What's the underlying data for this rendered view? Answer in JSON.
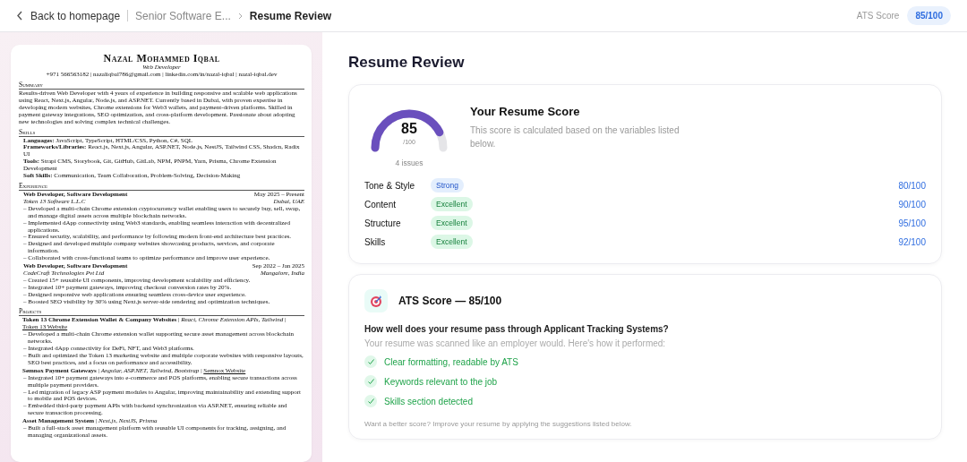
{
  "topbar": {
    "back": "Back to homepage",
    "crumb": "Senior Software E...",
    "current": "Resume Review",
    "ats_label": "ATS Score",
    "ats_value": "85/100"
  },
  "resume": {
    "name": "Nazal Mohammed Iqbal",
    "role": "Web Developer",
    "contact": "+971 566563182 | nazaliqbal786@gmail.com | linkedin.com/in/nazal-iqbal | nazal-iqbal.dev",
    "summary_heading": "Summary",
    "summary": "Results-driven Web Developer with 4 years of experience in building responsive and scalable web applications using React, Next.js, Angular, Node.js, and ASP.NET. Currently based in Dubai, with proven expertise in developing modern websites, Chrome extensions for Web3 wallets, and payment-driven platforms. Skilled in payment gateway integrations, SEO optimization, and cross-platform development. Passionate about adopting new technologies and solving complex technical challenges.",
    "skills_heading": "Skills",
    "skills": [
      "**Languages:** JavaScript, TypeScript, HTML/CSS, Python, C#, SQL",
      "**Frameworks/Libraries:** React.js, Next.js, Angular, ASP.NET, Node.js, NestJS, Tailwind CSS, Shadcn, Radix UI",
      "**Tools:** Strapi CMS, Storybook, Git, GitHub, GitLab, NPM, PNPM, Yarn, Prisma, Chrome Extension Development",
      "**Soft Skills:** Communication, Team Collaboration, Problem-Solving, Decision-Making"
    ],
    "experience_heading": "Experience",
    "jobs": [
      {
        "title": "Web Developer, Software Development",
        "dates": "May 2025 – Present",
        "company": "Token 13 Software L.L.C",
        "place": "Dubai, UAE",
        "bullets": [
          "– Developed a multi-chain Chrome extension cryptocurrency wallet enabling users to securely buy, sell, swap, and manage digital assets across multiple blockchain networks.",
          "– Implemented dApp connectivity using Web3 standards, enabling seamless interaction with decentralized applications.",
          "– Ensured security, scalability, and performance by following modern front-end architecture best practices.",
          "– Designed and developed multiple company websites showcasing products, services, and corporate information.",
          "– Collaborated with cross-functional teams to optimize performance and improve user experience."
        ]
      },
      {
        "title": "Web Developer, Software Development",
        "dates": "Sep 2022 – Jan 2025",
        "company": "CodeCraft Technologies Pvt Ltd",
        "place": "Mangalore, India",
        "bullets": [
          "– Created 15+ reusable UI components, improving development scalability and efficiency.",
          "– Integrated 10+ payment gateways, improving checkout conversion rates by 20%.",
          "– Designed responsive web applications ensuring seamless cross-device user experience.",
          "– Boosted SEO visibility by 30% using Next.js server-side rendering and optimization techniques."
        ]
      }
    ],
    "projects_heading": "Projects",
    "projects": [
      {
        "header": "**Token 13 Chrome Extension Wallet & Company Websites** | *React, Chrome Extension APIs, Tailwind* |",
        "link": "Token 13 Website",
        "bullets": [
          "– Developed a multi-chain Chrome extension wallet supporting secure asset management across blockchain networks.",
          "– Integrated dApp connectivity for DeFi, NFT, and Web3 platforms.",
          "– Built and optimized the Token 13 marketing website and multiple corporate websites with responsive layouts, SEO best practices, and a focus on performance and accessibility."
        ]
      },
      {
        "header": "**Semnox Payment Gateways** | *Angular, ASP.NET, Tailwind, Bootstrap* |",
        "link": "Semnox Website",
        "bullets": [
          "– Integrated 10+ payment gateways into e-commerce and POS platforms, enabling secure transactions across multiple payment providers.",
          "– Led migration of legacy ASP payment modules to Angular, improving maintainability and extending support to mobile and POS devices.",
          "– Embedded third-party payment APIs with backend synchronization via ASP.NET, ensuring reliable and secure transaction processing."
        ]
      },
      {
        "header": "**Asset Management System** | *Next.js, NestJS, Prisma*",
        "bullets": [
          "– Built a full-stack asset management platform with reusable UI components for tracking, assigning, and managing organizational assets."
        ]
      }
    ]
  },
  "review": {
    "title": "Resume Review",
    "score_card": {
      "score": "85",
      "out_of": "/100",
      "issues": "4 issues",
      "title": "Your Resume Score",
      "subtitle": "This score is calculated based on the variables listed below.",
      "categories": [
        {
          "label": "Tone & Style",
          "badge": "Strong",
          "kind": "strong",
          "score": "80/100"
        },
        {
          "label": "Content",
          "badge": "Excellent",
          "kind": "excellent",
          "score": "90/100"
        },
        {
          "label": "Structure",
          "badge": "Excellent",
          "kind": "excellent",
          "score": "95/100"
        },
        {
          "label": "Skills",
          "badge": "Excellent",
          "kind": "excellent",
          "score": "92/100"
        }
      ]
    },
    "ats_card": {
      "title": "ATS Score — 85/100",
      "question": "How well does your resume pass through Applicant Tracking Systems?",
      "intro": "Your resume was scanned like an employer would. Here's how it performed:",
      "checks": [
        {
          "text": "Clear formatting, readable by ATS",
          "kind": "pass"
        },
        {
          "text": "Keywords relevant to the job",
          "kind": "pass"
        },
        {
          "text": "Skills section detected",
          "kind": "pass"
        }
      ],
      "footer": "Want a better score? Improve your resume by applying the suggestions listed below."
    }
  }
}
